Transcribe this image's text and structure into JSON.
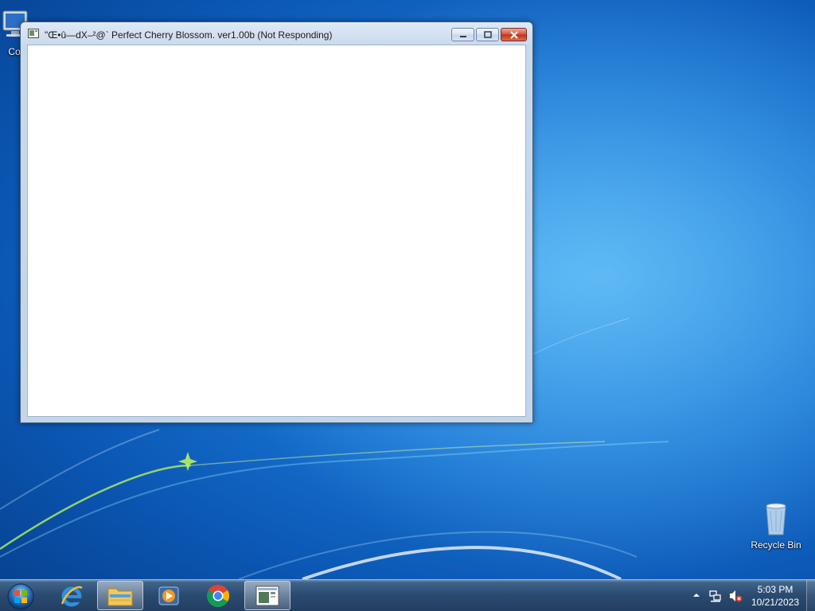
{
  "desktop": {
    "icons": [
      {
        "label": "Co",
        "icon": "computer-icon"
      },
      {
        "label": "Recycle Bin",
        "icon": "recycle-bin-icon"
      }
    ]
  },
  "window": {
    "title": "\"Œ•û—dX–²@` Perfect Cherry Blossom. ver1.00b (Not Responding)",
    "icon": "app-window-icon",
    "buttons": {
      "minimize": "minimize-icon",
      "maximize": "maximize-icon",
      "close": "close-icon"
    }
  },
  "taskbar": {
    "start": "windows-start-orb-icon",
    "pinned": [
      {
        "name": "internet-explorer",
        "icon": "internet-explorer-icon",
        "active": false
      },
      {
        "name": "windows-explorer",
        "icon": "folder-icon",
        "active": true
      },
      {
        "name": "media-player",
        "icon": "media-player-icon",
        "active": false
      },
      {
        "name": "chrome",
        "icon": "chrome-icon",
        "active": false
      },
      {
        "name": "touhou-window",
        "icon": "app-window-icon",
        "active": true
      }
    ],
    "tray": {
      "time": "5:03 PM",
      "date": "10/21/2023"
    }
  },
  "colors": {
    "desktop_blue": "#1a78d6",
    "close_red": "#c0301b",
    "taskbar": "#2a4a70"
  }
}
